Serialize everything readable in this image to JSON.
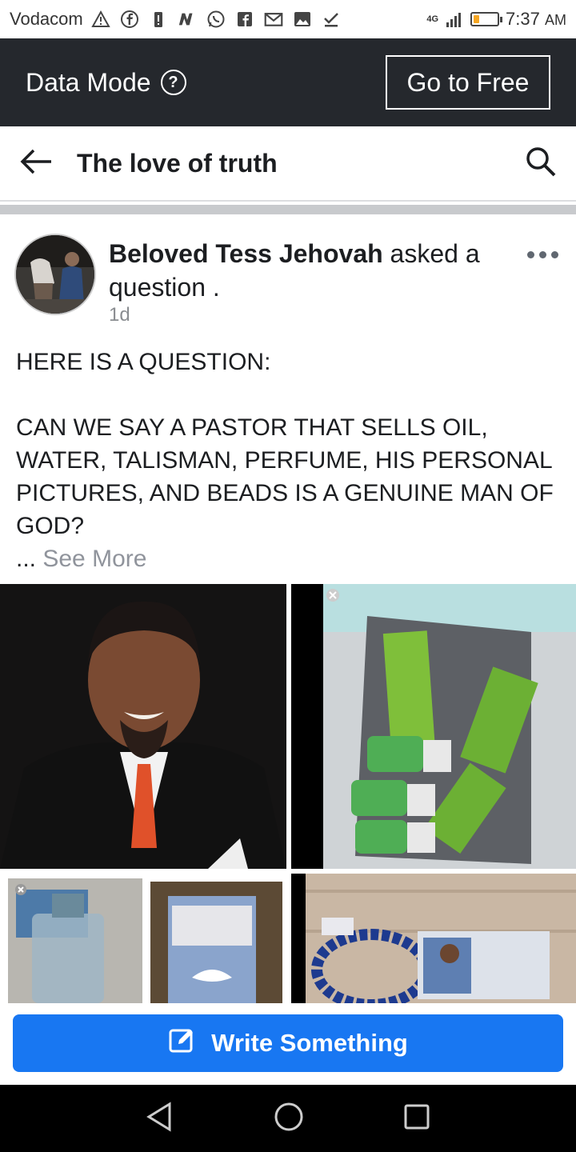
{
  "status_bar": {
    "carrier": "Vodacom",
    "network": "4G",
    "time": "7:37",
    "ampm": "AM",
    "battery_level": 0.25,
    "battery_color": "#f5a623"
  },
  "data_banner": {
    "label": "Data Mode",
    "button": "Go to Free"
  },
  "header": {
    "title": "The love of truth"
  },
  "post": {
    "author": "Beloved Tess Jehovah",
    "action": "asked a question .",
    "time": "1d",
    "line1": "HERE IS A QUESTION:",
    "line2": "CAN WE SAY A PASTOR THAT SELLS OIL, WATER,  TALISMAN, PERFUME, HIS PERSONAL PICTURES, AND BEADS IS A GENUINE MAN OF GOD?",
    "ellipsis": "...",
    "see_more": "See More",
    "images": [
      {
        "icon": "portrait-photo"
      },
      {
        "icon": "products-photo"
      },
      {
        "icon": "bottles-photo"
      },
      {
        "icon": "bracelet-photo"
      }
    ]
  },
  "composer": {
    "button": "Write Something"
  },
  "colors": {
    "accent": "#1877f2",
    "banner_bg": "#25282d"
  }
}
